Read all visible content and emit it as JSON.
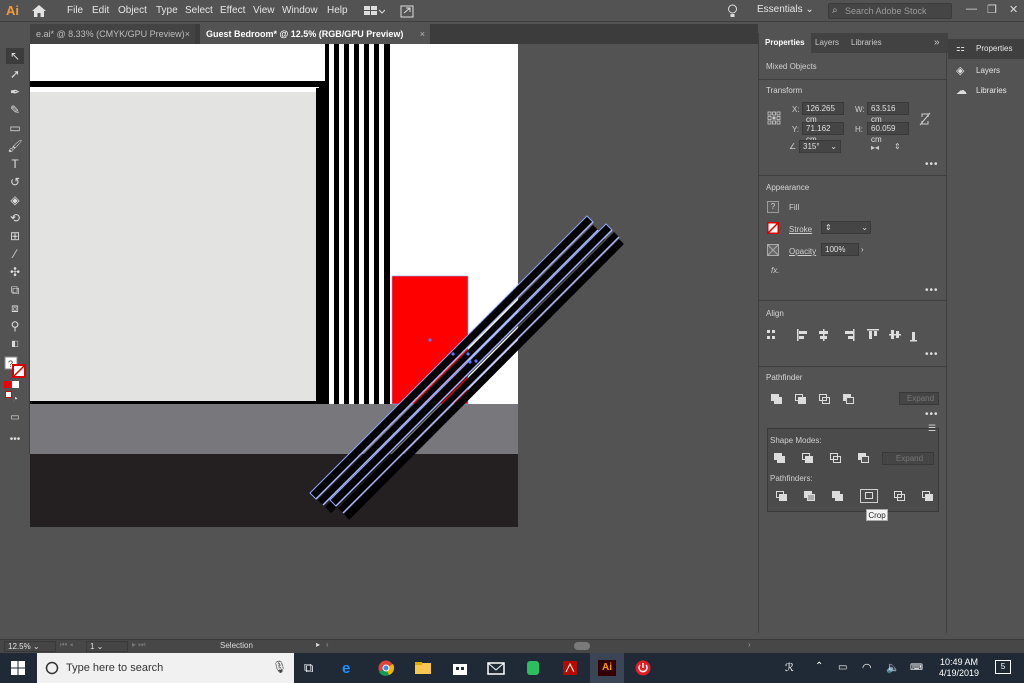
{
  "app": {
    "logo": "Ai"
  },
  "menu": [
    "File",
    "Edit",
    "Object",
    "Type",
    "Select",
    "Effect",
    "View",
    "Window",
    "Help"
  ],
  "workspace": {
    "label": "Essentials",
    "search_placeholder": "Search Adobe Stock"
  },
  "tabs": [
    {
      "label": "e.ai* @ 8.33% (CMYK/GPU Preview)",
      "close": "×"
    },
    {
      "label": "Guest Bedroom* @ 12.5% (RGB/GPU Preview)",
      "close": "×"
    }
  ],
  "status": {
    "zoom": "12.5%",
    "artboard": "1",
    "mode": "Selection"
  },
  "panel": {
    "tabs": [
      "Properties",
      "Layers",
      "Libraries"
    ],
    "selection_type": "Mixed Objects",
    "transform": {
      "title": "Transform",
      "x_label": "X:",
      "x": "126.265 cm",
      "y_label": "Y:",
      "y": "71.162 cm",
      "w_label": "W:",
      "w": "63.516 cm",
      "h_label": "H:",
      "h": "60.059 cm",
      "angle": "315°"
    },
    "appearance": {
      "title": "Appearance",
      "fill_label": "Fill",
      "fill_icon": "?",
      "stroke_label": "Stroke",
      "opacity_label": "Opacity",
      "opacity": "100%",
      "fx_label": "fx."
    },
    "align": {
      "title": "Align"
    },
    "pathfinder": {
      "title": "Pathfinder",
      "expand_label": "Expand",
      "shape_modes_label": "Shape Modes:",
      "flyout_expand_label": "Expand",
      "pathfinders_label": "Pathfinders:",
      "tooltip": "Crop"
    },
    "more": "•••"
  },
  "mini_panel": [
    "Properties",
    "Layers",
    "Libraries"
  ],
  "taskbar": {
    "search_placeholder": "Type here to search",
    "time": "10:49 AM",
    "date": "4/19/2019",
    "notifications": "5"
  },
  "colors": {
    "selection_blue": "#8fa8ff",
    "red_rect": "#ff0000",
    "app_bg": "#535353"
  }
}
